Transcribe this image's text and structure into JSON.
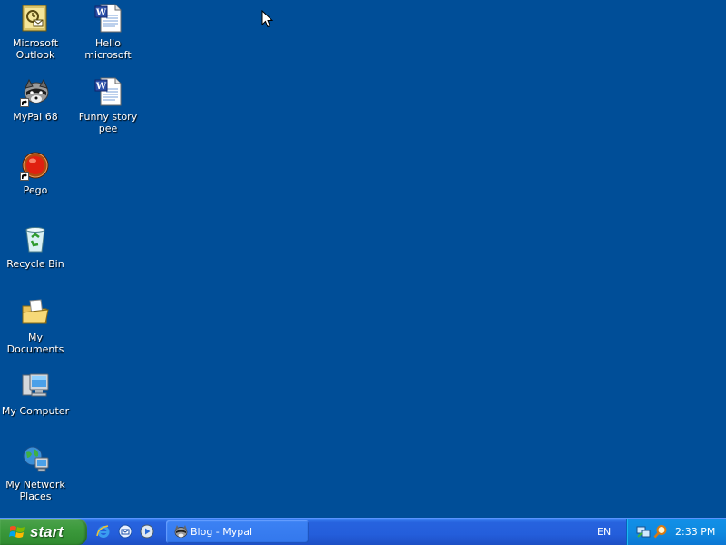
{
  "desktop": {
    "background_color": "#004e98",
    "icons": [
      {
        "label": "Microsoft Outlook",
        "icon": "outlook-icon",
        "shortcut": false
      },
      {
        "label": "Hello microsoft",
        "icon": "word-document-icon",
        "shortcut": false
      },
      {
        "label": "MyPal 68",
        "icon": "mypal-browser-icon",
        "shortcut": true
      },
      {
        "label": "Funny story pee",
        "icon": "word-document-icon",
        "shortcut": false
      },
      {
        "label": "Pego",
        "icon": "pego-icon",
        "shortcut": true
      },
      {
        "label": "Recycle Bin",
        "icon": "recycle-bin-icon",
        "shortcut": false
      },
      {
        "label": "My Documents",
        "icon": "my-documents-icon",
        "shortcut": false
      },
      {
        "label": "My Computer",
        "icon": "my-computer-icon",
        "shortcut": false
      },
      {
        "label": "My Network Places",
        "icon": "network-places-icon",
        "shortcut": false
      }
    ]
  },
  "taskbar": {
    "start_label": "start",
    "quick_launch": [
      {
        "icon": "internet-explorer-icon"
      },
      {
        "icon": "outlook-express-icon"
      },
      {
        "icon": "media-player-icon"
      }
    ],
    "tasks": [
      {
        "label": "Blog - Mypal",
        "icon": "mypal-browser-icon"
      }
    ],
    "language": "EN",
    "tray_icons": [
      {
        "icon": "network-tray-icon"
      },
      {
        "icon": "search-tray-icon"
      }
    ],
    "clock": "2:33 PM",
    "colors": {
      "taskbar": "#245edb",
      "start_button": "#3c9a3c",
      "tray": "#0f8ae0"
    }
  }
}
